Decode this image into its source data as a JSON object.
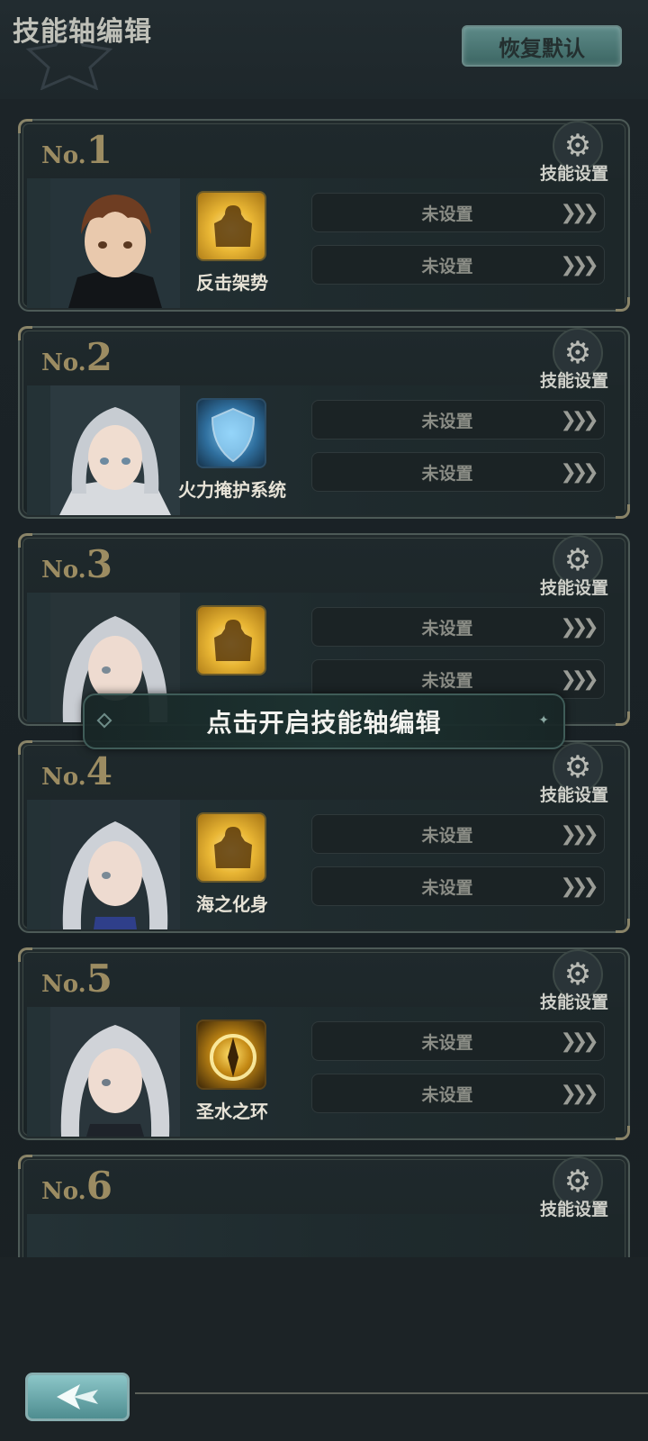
{
  "header": {
    "title": "技能轴编辑",
    "reset_label": "恢复默认"
  },
  "common": {
    "gear_label": "技能设置",
    "slot_empty": "未设置",
    "arrow_glyph": "❯❯❯"
  },
  "cards": [
    {
      "prefix": "No.",
      "num": "1",
      "skill": "反击架势",
      "icon": "gold-warrior-icon",
      "slots": [
        "未设置",
        "未设置"
      ]
    },
    {
      "prefix": "No.",
      "num": "2",
      "skill": "火力掩护系统",
      "icon": "blue-shield-icon",
      "slots": [
        "未设置",
        "未设置"
      ]
    },
    {
      "prefix": "No.",
      "num": "3",
      "skill": "",
      "icon": "gold-warrior-icon",
      "slots": [
        "未设置",
        "未设置"
      ]
    },
    {
      "prefix": "No.",
      "num": "4",
      "skill": "海之化身",
      "icon": "gold-warrior-icon",
      "slots": [
        "未设置",
        "未设置"
      ]
    },
    {
      "prefix": "No.",
      "num": "5",
      "skill": "圣水之环",
      "icon": "golden-ring-icon",
      "slots": [
        "未设置",
        "未设置"
      ]
    },
    {
      "prefix": "No.",
      "num": "6",
      "skill": "",
      "icon": "",
      "slots": []
    }
  ],
  "banner": {
    "text": "点击开启技能轴编辑"
  },
  "footer": {
    "back_icon": "back-arrow-icon"
  },
  "colors": {
    "accent_teal": "#5d8a88",
    "number_gold": "#9c8c62",
    "background": "#1a2226"
  }
}
